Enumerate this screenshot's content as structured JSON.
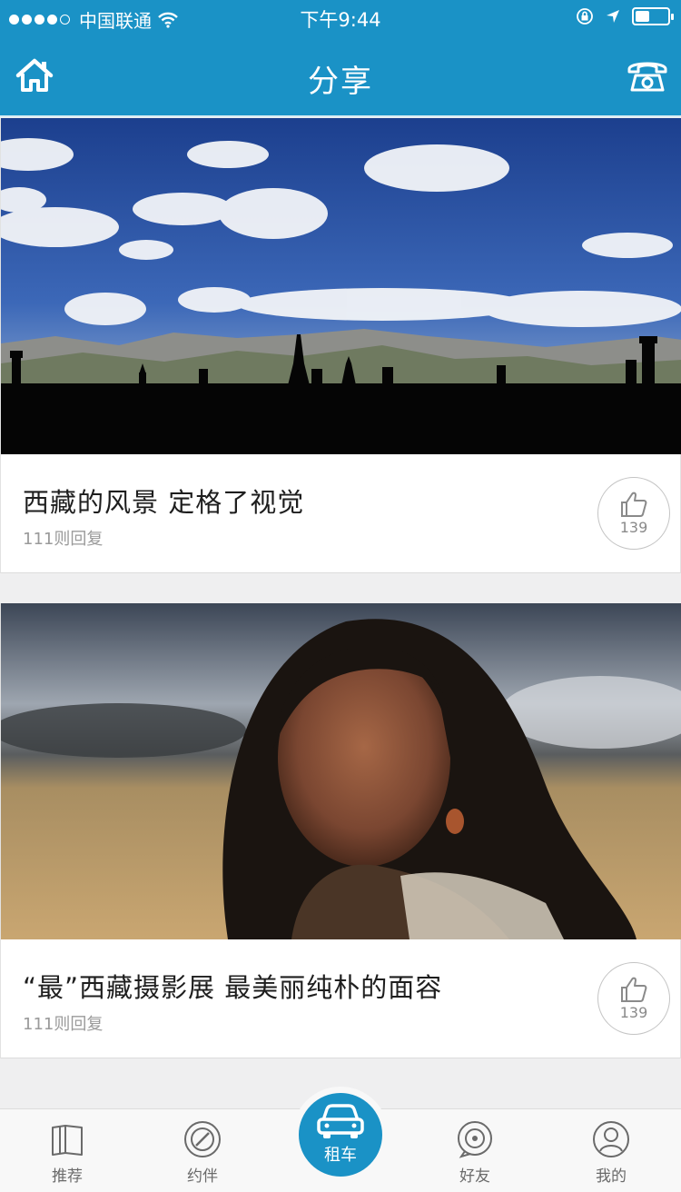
{
  "status_bar": {
    "carrier": "中国联通",
    "time": "下午9:44",
    "battery_level": 0.45
  },
  "nav": {
    "title": "分享",
    "left_icon": "home-icon",
    "right_icon": "phone-icon"
  },
  "posts": [
    {
      "title": "西藏的风景  定格了视觉",
      "replies": "111则回复",
      "likes": "139",
      "image": "tibet-landscape"
    },
    {
      "title": "“最”西藏摄影展  最美丽纯朴的面容",
      "replies": "111则回复",
      "likes": "139",
      "image": "tibetan-woman-portrait"
    }
  ],
  "tabs": [
    {
      "label": "推荐",
      "icon": "book-icon"
    },
    {
      "label": "约伴",
      "icon": "compass-icon"
    },
    {
      "label": "租车",
      "icon": "car-icon",
      "active": true
    },
    {
      "label": "好友",
      "icon": "chat-icon"
    },
    {
      "label": "我的",
      "icon": "user-icon"
    }
  ],
  "colors": {
    "header": "#1a92c6",
    "tabbar": "#f8f8f8",
    "background": "#efeff0"
  }
}
